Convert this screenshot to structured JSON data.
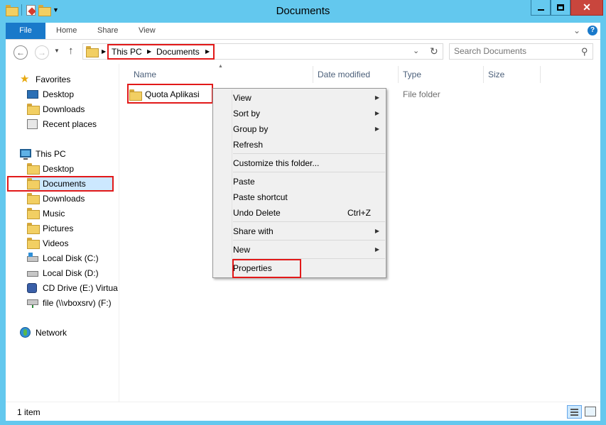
{
  "window": {
    "title": "Documents"
  },
  "ribbon": {
    "tabs": [
      "File",
      "Home",
      "Share",
      "View"
    ]
  },
  "address": {
    "crumbs": [
      "This PC",
      "Documents"
    ]
  },
  "search": {
    "placeholder": "Search Documents"
  },
  "nav": {
    "favorites_label": "Favorites",
    "favorites": [
      "Desktop",
      "Downloads",
      "Recent places"
    ],
    "thispc_label": "This PC",
    "thispc": [
      "Desktop",
      "Documents",
      "Downloads",
      "Music",
      "Pictures",
      "Videos",
      "Local Disk (C:)",
      "Local Disk (D:)",
      "CD Drive (E:) VirtualBox",
      "file (\\\\vboxsrv) (F:)"
    ],
    "network_label": "Network"
  },
  "columns": [
    "Name",
    "Date modified",
    "Type",
    "Size"
  ],
  "files": [
    {
      "name": "Quota Aplikasi",
      "type": "File folder"
    }
  ],
  "context_menu": {
    "view": "View",
    "sort_by": "Sort by",
    "group_by": "Group by",
    "refresh": "Refresh",
    "customize": "Customize this folder...",
    "paste": "Paste",
    "paste_shortcut": "Paste shortcut",
    "undo_delete": "Undo Delete",
    "undo_shortcut": "Ctrl+Z",
    "share_with": "Share with",
    "new": "New",
    "properties": "Properties"
  },
  "status": {
    "count": "1 item"
  },
  "colors": {
    "highlight": "#e21919",
    "titlebar": "#63c8ee",
    "file_tab": "#1979ca"
  }
}
